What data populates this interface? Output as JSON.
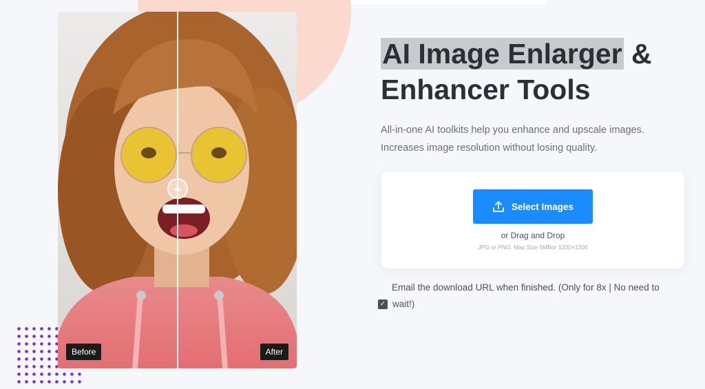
{
  "headline": {
    "highlighted": "AI Image Enlarger",
    "rest_line1": " &",
    "line2": "Enhancer Tools"
  },
  "subtitle": {
    "line1": "All-in-one AI toolkits help you enhance and upscale images.",
    "line2": "Increases image resolution without losing quality."
  },
  "compare": {
    "before_label": "Before",
    "after_label": "After",
    "handle_icon": "arrows-left-right-icon"
  },
  "upload": {
    "button_label": "Select Images",
    "button_icon": "upload-icon",
    "drag_text": "or Drag and Drop",
    "hint_text": "JPG or PNG. Max Size 5MBor 1200×1200",
    "accent_color": "#1a8cff"
  },
  "email_option": {
    "checked": true,
    "line1": "Email the download URL when finished. (Only for 8x | No need to",
    "line2": "wait!)"
  },
  "colors": {
    "background": "#f6f7fb",
    "peach": "#fbd9cf",
    "dots": "#7a2fd0",
    "heading": "#2b2f36"
  }
}
